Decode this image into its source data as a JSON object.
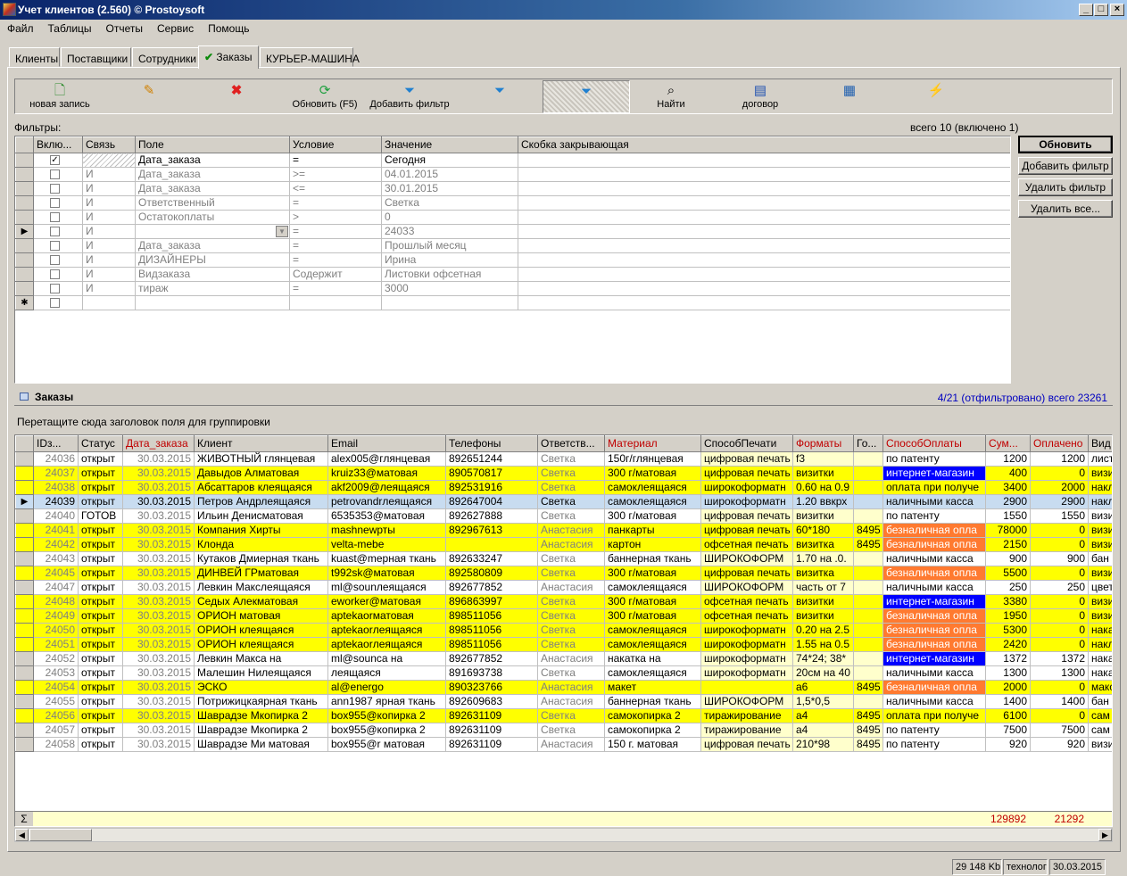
{
  "window": {
    "title": "Учет клиентов (2.560) © Prostoysoft"
  },
  "menu": [
    "Файл",
    "Таблицы",
    "Отчеты",
    "Сервис",
    "Помощь"
  ],
  "tabs": [
    "Клиенты",
    "Поставщики",
    "Сотрудники",
    "Заказы",
    "КУРЬЕР-МАШИНА"
  ],
  "active_tab": "Заказы",
  "toolbar": {
    "new": "новая запись",
    "refresh": "Обновить (F5)",
    "add_filter": "Добавить фильтр",
    "find": "Найти",
    "contract": "договор"
  },
  "filters": {
    "label": "Фильтры:",
    "summary": "всего 10 (включено 1)",
    "columns": [
      "Вклю...",
      "Связь",
      "Поле",
      "Условие",
      "Значение",
      "Скобка закрывающая"
    ],
    "rows": [
      {
        "on": true,
        "link": "",
        "field": "Дата_заказа",
        "cond": "=",
        "value": "Сегодня"
      },
      {
        "on": false,
        "link": "И",
        "field": "Дата_заказа",
        "cond": ">=",
        "value": "04.01.2015"
      },
      {
        "on": false,
        "link": "И",
        "field": "Дата_заказа",
        "cond": "<=",
        "value": "30.01.2015"
      },
      {
        "on": false,
        "link": "И",
        "field": "Ответственный",
        "cond": "=",
        "value": "Светка"
      },
      {
        "on": false,
        "link": "И",
        "field": "Остатокоплаты",
        "cond": ">",
        "value": "0"
      },
      {
        "on": false,
        "link": "И",
        "field": "",
        "cond": "=",
        "value": "24033"
      },
      {
        "on": false,
        "link": "И",
        "field": "Дата_заказа",
        "cond": "=",
        "value": "Прошлый месяц"
      },
      {
        "on": false,
        "link": "И",
        "field": "ДИЗАЙНЕРЫ",
        "cond": "=",
        "value": "Ирина"
      },
      {
        "on": false,
        "link": "И",
        "field": "Видзаказа",
        "cond": "Содержит",
        "value": "Листовки офсетная"
      },
      {
        "on": false,
        "link": "И",
        "field": "тираж",
        "cond": "=",
        "value": "3000"
      }
    ],
    "buttons": [
      "Обновить",
      "Добавить фильтр",
      "Удалить фильтр",
      "Удалить все..."
    ]
  },
  "orders": {
    "title": "Заказы",
    "summary": "4/21 (отфильтровано) всего 23261",
    "group_hint": "Перетащите сюда заголовок поля для группировки",
    "columns": [
      "IDз...",
      "Статус",
      "Дата_заказа",
      "Клиент",
      "Email",
      "Телефоны",
      "Ответств...",
      "Материал",
      "СпособПечати",
      "Форматы",
      "Го...",
      "СпособОплаты",
      "Сум...",
      "Оплачено",
      "Вид"
    ],
    "rows": [
      [
        "24036",
        "открыт",
        "30.03.2015",
        "ЖИВОТНЫЙ глянцевая",
        "alex005@глянцевая",
        "892651244",
        "Светка",
        "150г/глянцевая",
        "цифровая печать",
        "f3",
        "",
        "по патенту",
        "1200",
        "1200",
        "лист"
      ],
      [
        "24037",
        "открыт",
        "30.03.2015",
        "Давыдов Алматовая",
        "kruiz33@матовая",
        "890570817",
        "Светка",
        "300 г/матовая",
        "цифровая печать",
        "визитки",
        "",
        "интернет-магазин",
        "400",
        "0",
        "визи"
      ],
      [
        "24038",
        "открыт",
        "30.03.2015",
        "Абсаттаров клеящаяся",
        "akf2009@леящаяся",
        "892531916",
        "Светка",
        "самоклеящаяся",
        "широкоформатн",
        "0.60 на 0.9",
        "",
        "оплата при получе",
        "3400",
        "2000",
        "накл"
      ],
      [
        "24039",
        "открыт",
        "30.03.2015",
        "Петров Андрлеящаяся",
        "petrovandrлеящаяся",
        "892647004",
        "Светка",
        "самоклеящаяся",
        "широкоформатн",
        "1.20 ввкрх",
        "",
        "наличными касса",
        "2900",
        "2900",
        "накл"
      ],
      [
        "24040",
        "ГОТОВ",
        "30.03.2015",
        "Ильин Денисматовая",
        "6535353@матовая",
        "892627888",
        "Светка",
        "300 г/матовая",
        "цифровая печать",
        "визитки",
        "",
        "по патенту",
        "1550",
        "1550",
        "визи"
      ],
      [
        "24041",
        "открыт",
        "30.03.2015",
        "Компания Хирты",
        "mashnewрты",
        "892967613",
        "Анастасия",
        "панкарты",
        "цифровая печать",
        "60*180",
        "8495",
        "безналичная опла",
        "78000",
        "0",
        "визи"
      ],
      [
        "24042",
        "открыт",
        "30.03.2015",
        "Клонда",
        "velta-mebe",
        "",
        "Анастасия",
        "картон",
        "офсетная печать",
        "визитка",
        "8495",
        "безналичная опла",
        "2150",
        "0",
        "визи"
      ],
      [
        "24043",
        "открыт",
        "30.03.2015",
        "Кутаков Дмиерная ткань",
        "kuast@mерная ткань",
        "892633247",
        "Светка",
        "баннерная ткань",
        "ШИРОКОФОРМ",
        "1.70 на .0.",
        "",
        "наличными касса",
        "900",
        "900",
        "бан"
      ],
      [
        "24045",
        "открыт",
        "30.03.2015",
        "ДИНВЕЙ ГРматовая",
        "t992sk@матовая",
        "892580809",
        "Светка",
        "300 г/матовая",
        "цифровая печать",
        "визитка",
        "",
        "безналичная опла",
        "5500",
        "0",
        "визи"
      ],
      [
        "24047",
        "открыт",
        "30.03.2015",
        "Левкин Макслеящаяся",
        "ml@sounлеящаяся",
        "892677852",
        "Анастасия",
        "самоклеящаяся",
        "ШИРОКОФОРМ",
        "часть от 7",
        "",
        "наличными касса",
        "250",
        "250",
        "цвет"
      ],
      [
        "24048",
        "открыт",
        "30.03.2015",
        "Седых Алекматовая",
        "eworker@матовая",
        "896863997",
        "Светка",
        "300 г/матовая",
        "офсетная печать",
        "визитки",
        "",
        "интернет-магазин",
        "3380",
        "0",
        "визи"
      ],
      [
        "24049",
        "открыт",
        "30.03.2015",
        "ОРИОН матовая",
        "aptekaorматовая",
        "898511056",
        "Светка",
        "300 г/матовая",
        "офсетная печать",
        "визитки",
        "",
        "безналичная опла",
        "1950",
        "0",
        "визи"
      ],
      [
        "24050",
        "открыт",
        "30.03.2015",
        "ОРИОН клеящаяся",
        "aptekaorлеящаяся",
        "898511056",
        "Светка",
        "самоклеящаяся",
        "широкоформатн",
        "0.20 на 2.5",
        "",
        "безналичная опла",
        "5300",
        "0",
        "нака"
      ],
      [
        "24051",
        "открыт",
        "30.03.2015",
        "ОРИОН клеящаяся",
        "aptekaorлеящаяся",
        "898511056",
        "Светка",
        "самоклеящаяся",
        "широкоформатн",
        "1.55 на 0.5",
        "",
        "безналичная опла",
        "2420",
        "0",
        "накл"
      ],
      [
        "24052",
        "открыт",
        "30.03.2015",
        "Левкин Макса на",
        "ml@sounca на",
        "892677852",
        "Анастасия",
        "накатка на",
        "широкоформатн",
        "74*24; 38*",
        "",
        "интернет-магазин",
        "1372",
        "1372",
        "нака"
      ],
      [
        "24053",
        "открыт",
        "30.03.2015",
        "Малешин Нилеящаяся",
        "леящаяся",
        "891693738",
        "Светка",
        "самоклеящаяся",
        "широкоформатн",
        "20см на 40",
        "",
        "наличными касса",
        "1300",
        "1300",
        "нака"
      ],
      [
        "24054",
        "открыт",
        "30.03.2015",
        "ЭСКО",
        "al@energo",
        "890323766",
        "Анастасия",
        "макет",
        "",
        "а6",
        "8495",
        "безналичная опла",
        "2000",
        "0",
        "макс"
      ],
      [
        "24055",
        "открыт",
        "30.03.2015",
        "Потрижицкаярная ткань",
        "ann1987 ярная ткань",
        "892609683",
        "Анастасия",
        "баннерная ткань",
        "ШИРОКОФОРМ",
        "1,5*0,5",
        "",
        "наличными касса",
        "1400",
        "1400",
        "бан"
      ],
      [
        "24056",
        "открыт",
        "30.03.2015",
        "Шаврадзе Мкопирка 2",
        "box955@копирка 2",
        "892631109",
        "Светка",
        "самокопирка 2",
        "тиражирование",
        "а4",
        "8495",
        "оплата при получе",
        "6100",
        "0",
        "сам"
      ],
      [
        "24057",
        "открыт",
        "30.03.2015",
        "Шаврадзе Мкопирка 2",
        "box955@копирка 2",
        "892631109",
        "Светка",
        "самокопирка 2",
        "тиражирование",
        "а4",
        "8495",
        "по патенту",
        "7500",
        "7500",
        "сам"
      ],
      [
        "24058",
        "открыт",
        "30.03.2015",
        "Шаврадзе Ми матовая",
        "box955@r матовая",
        "892631109",
        "Анастасия",
        "150 г. матовая",
        "цифровая печать",
        "210*98",
        "8495",
        "по патенту",
        "920",
        "920",
        "визи"
      ]
    ],
    "totals": {
      "sum": "129892",
      "paid": "21292"
    },
    "sigma": "Σ"
  },
  "status": {
    "memory": "29 148 Kb",
    "user": "технолог",
    "date": "30.03.2015"
  }
}
